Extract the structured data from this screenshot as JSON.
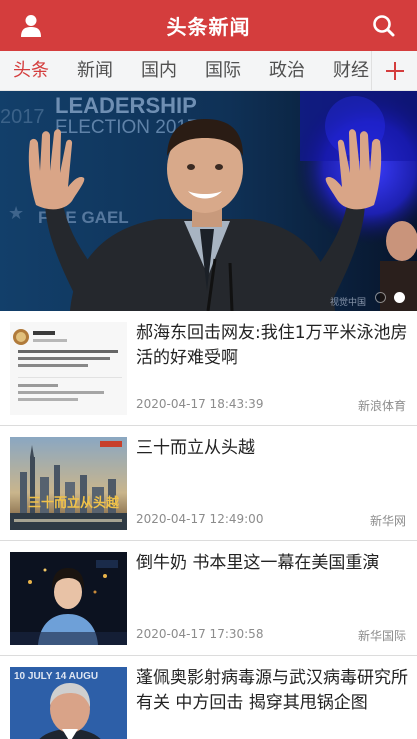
{
  "header": {
    "title": "头条新闻",
    "user_icon": "user-icon",
    "search_icon": "search-icon",
    "brand_color": "#d43d3d"
  },
  "tabs": {
    "items": [
      {
        "label": "头条",
        "active": true
      },
      {
        "label": "新闻",
        "active": false
      },
      {
        "label": "国内",
        "active": false
      },
      {
        "label": "国际",
        "active": false
      },
      {
        "label": "政治",
        "active": false
      },
      {
        "label": "财经",
        "active": false
      }
    ],
    "add_icon": "plus-icon"
  },
  "banner": {
    "backdrop_line1": "LEADERSHIP",
    "backdrop_line2": "ELECTION 2017",
    "backdrop_line3": "FINE GAEL",
    "slides": 2,
    "active_slide": 2
  },
  "news": [
    {
      "title": "郝海东回击网友:我住1万平米泳池房 活的好难受啊",
      "time": "2020-04-17 18:43:39",
      "source": "新浪体育",
      "thumb": "weibo-post-screenshot"
    },
    {
      "title": "三十而立从头越",
      "time": "2020-04-17 12:49:00",
      "source": "新华网",
      "thumb": "city-skyline-poster",
      "thumb_caption": "三十而立从头越"
    },
    {
      "title": "倒牛奶 书本里这一幕在美国重演",
      "time": "2020-04-17 17:30:58",
      "source": "新华国际",
      "thumb": "news-anchor"
    },
    {
      "title": "蓬佩奥影射病毒源与武汉病毒研究所有关 中方回击 揭穿其甩锅企图",
      "thumb": "politician-portrait",
      "thumb_caption": "10 JULY 14 AUGU"
    }
  ]
}
